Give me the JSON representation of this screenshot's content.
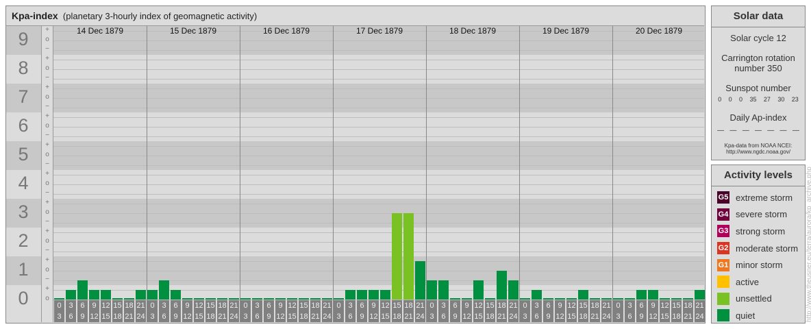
{
  "header": {
    "title": "Kpa-index",
    "subtitle": "(planetary 3-hourly index of geomagnetic activity)"
  },
  "chart_data": {
    "type": "bar",
    "title": "Kpa-index",
    "ylabel": "Kp",
    "ylim": [
      0,
      9.5
    ],
    "y_ticks": [
      "0",
      "1",
      "2",
      "3",
      "4",
      "5",
      "6",
      "7",
      "8",
      "9"
    ],
    "minor_ticks": [
      "o",
      "+",
      "−"
    ],
    "days": [
      "14 Dec 1879",
      "15 Dec 1879",
      "16 Dec 1879",
      "17 Dec 1879",
      "18 Dec 1879",
      "19 Dec 1879",
      "20 Dec 1879"
    ],
    "intervals": [
      [
        "0",
        "3"
      ],
      [
        "3",
        "6"
      ],
      [
        "6",
        "9"
      ],
      [
        "9",
        "12"
      ],
      [
        "12",
        "15"
      ],
      [
        "15",
        "18"
      ],
      [
        "18",
        "21"
      ],
      [
        "21",
        "24"
      ]
    ],
    "values": [
      [
        0,
        0.33,
        0.67,
        0.33,
        0.33,
        0,
        0,
        0.33
      ],
      [
        0.33,
        0.67,
        0.33,
        0,
        0,
        0,
        0,
        0
      ],
      [
        0,
        0,
        0,
        0,
        0,
        0,
        0,
        0
      ],
      [
        0,
        0.33,
        0.33,
        0.33,
        0.33,
        3,
        3,
        1.33
      ],
      [
        0.67,
        0.67,
        0,
        0,
        0.67,
        0,
        1,
        0.67
      ],
      [
        0,
        0.33,
        0,
        0,
        0,
        0.33,
        0,
        0
      ],
      [
        0,
        0,
        0.33,
        0.33,
        0,
        0,
        0,
        0.33
      ]
    ]
  },
  "solar": {
    "title": "Solar data",
    "cycle": "Solar cycle 12",
    "carrington1": "Carrington rotation",
    "carrington2": "number 350",
    "ssn_label": "Sunspot number",
    "ssn": [
      "0",
      "0",
      "0",
      "35",
      "27",
      "30",
      "23"
    ],
    "ap_label": "Daily Ap-index",
    "ap": [
      "—",
      "—",
      "—",
      "—",
      "—",
      "—",
      "—"
    ],
    "src1": "Kpa-data from NOAA NCEI:",
    "src2": "http://www.ngdc.noaa.gov/"
  },
  "activity": {
    "title": "Activity levels",
    "levels": [
      {
        "badge": "G5",
        "label": "extreme storm",
        "color": "#4a0028"
      },
      {
        "badge": "G4",
        "label": "severe storm",
        "color": "#70003c"
      },
      {
        "badge": "G3",
        "label": "strong storm",
        "color": "#b0005a"
      },
      {
        "badge": "G2",
        "label": "moderate storm",
        "color": "#dd3322"
      },
      {
        "badge": "G1",
        "label": "minor storm",
        "color": "#ee7722"
      },
      {
        "badge": "",
        "label": "active",
        "color": "#ffc000"
      },
      {
        "badge": "",
        "label": "unsettled",
        "color": "#7ac124"
      },
      {
        "badge": "",
        "label": "quiet",
        "color": "#009040"
      }
    ]
  },
  "watermark": "http://www.theusner.eu/terra/aurora/kp_archive.php"
}
